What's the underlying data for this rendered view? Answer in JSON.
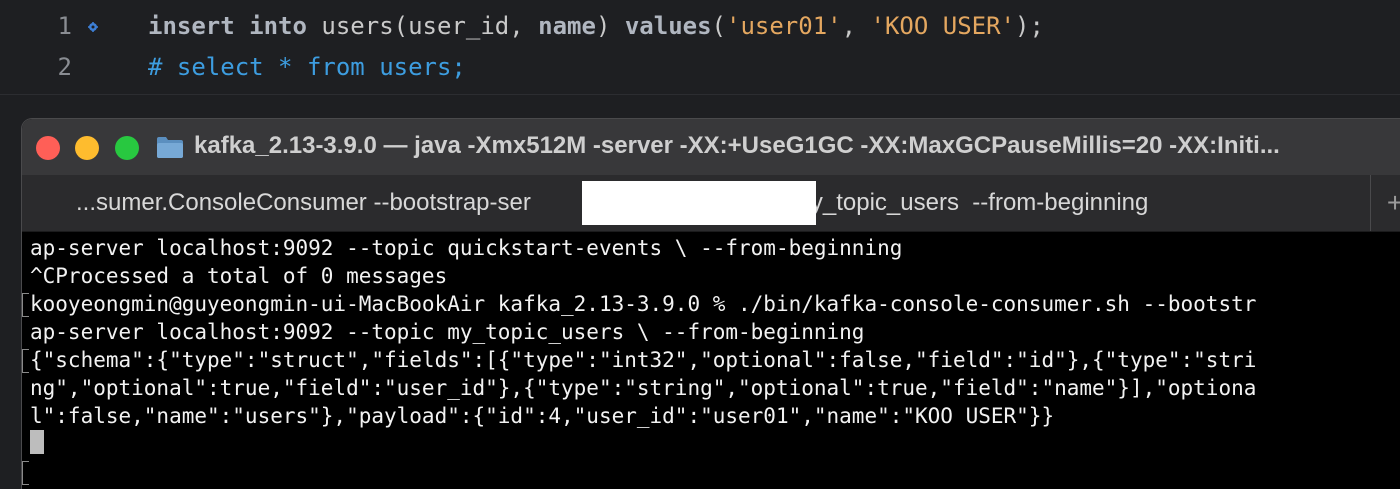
{
  "editor": {
    "lines": [
      {
        "number": "1",
        "tokens": [
          {
            "text": "insert",
            "cls": "kw"
          },
          {
            "text": " ",
            "cls": ""
          },
          {
            "text": "into",
            "cls": "kw"
          },
          {
            "text": " users(user_id, ",
            "cls": ""
          },
          {
            "text": "name",
            "cls": "kw"
          },
          {
            "text": ") ",
            "cls": ""
          },
          {
            "text": "values",
            "cls": "kw"
          },
          {
            "text": "(",
            "cls": ""
          },
          {
            "text": "'user01'",
            "cls": "str"
          },
          {
            "text": ", ",
            "cls": ""
          },
          {
            "text": "'KOO USER'",
            "cls": "str"
          },
          {
            "text": ");",
            "cls": ""
          }
        ]
      },
      {
        "number": "2",
        "tokens": [
          {
            "text": "# select * from users;",
            "cls": "cmt"
          }
        ]
      }
    ],
    "colors": {
      "keyword": "#b0b6c0",
      "string": "#e4a760",
      "comment": "#3d9de0",
      "background": "#1e1f22"
    }
  },
  "terminal": {
    "title": "kafka_2.13-3.9.0 — java -Xmx512M -server -XX:+UseG1GC -XX:MaxGCPauseMillis=20 -XX:Initi...",
    "tab": {
      "label": "...sumer.ConsoleConsumer --bootstrap-ser                            --topic my_topic_users  --from-beginning"
    },
    "add_tab": "+",
    "lines": [
      "ap-server localhost:9092 --topic quickstart-events \\ --from-beginning",
      "^CProcessed a total of 0 messages",
      "kooyeongmin@guyeongmin-ui-MacBookAir kafka_2.13-3.9.0 % ./bin/kafka-console-consumer.sh --bootstr",
      "ap-server localhost:9092 --topic my_topic_users \\ --from-beginning",
      "{\"schema\":{\"type\":\"struct\",\"fields\":[{\"type\":\"int32\",\"optional\":false,\"field\":\"id\"},{\"type\":\"stri",
      "ng\",\"optional\":true,\"field\":\"user_id\"},{\"type\":\"string\",\"optional\":true,\"field\":\"name\"}],\"optiona",
      "l\":false,\"name\":\"users\"},\"payload\":{\"id\":4,\"user_id\":\"user01\",\"name\":\"KOO USER\"}}"
    ],
    "colors": {
      "titlebar": "#38383a",
      "tabbar": "#2b2b2d",
      "background": "#000000",
      "text": "#f2f2f2"
    }
  }
}
